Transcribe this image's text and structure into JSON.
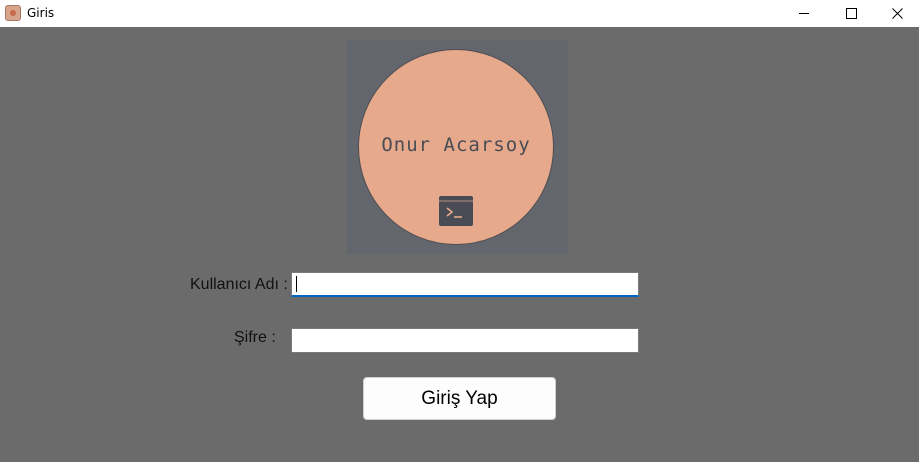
{
  "window": {
    "title": "Giris",
    "icon": "app-icon",
    "controls": [
      "minimize-icon",
      "maximize-icon",
      "close-icon"
    ]
  },
  "logo": {
    "name": "Onur Acarsoy",
    "icon": "terminal-icon",
    "circle_color": "#e6a98c",
    "background_color": "#64666d"
  },
  "form": {
    "username_label": "Kullanıcı Adı :",
    "username_value": "",
    "password_label": "Şifre :",
    "password_value": "",
    "submit_label": "Giriş Yap"
  },
  "colors": {
    "window_background": "#6b6b6b",
    "focus_accent": "#0067c0"
  }
}
